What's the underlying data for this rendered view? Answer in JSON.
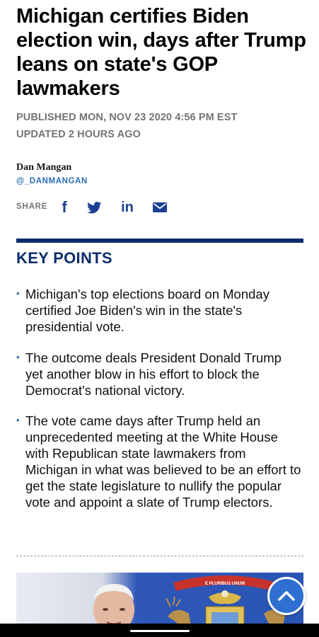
{
  "article": {
    "headline": "Michigan certifies Biden election win, days after Trump leans on state's GOP lawmakers",
    "published": "PUBLISHED MON, NOV 23 2020 4:56 PM EST",
    "updated": "UPDATED 2 HOURS AGO"
  },
  "author": {
    "name": "Dan Mangan",
    "handle": "@_DANMANGAN"
  },
  "share": {
    "label": "SHARE",
    "icons": [
      "facebook-icon",
      "twitter-icon",
      "linkedin-icon",
      "email-icon"
    ],
    "facebook_glyph": "f",
    "linkedin_glyph": "in"
  },
  "key_points": {
    "title": "KEY POINTS",
    "items": [
      "Michigan's top elections board on Monday certified Joe Biden's win in the state's presidential vote.",
      "The outcome deals President Donald Trump yet another blow in his effort to block the Democrat's national victory.",
      "The vote came days after Trump held an unprecedented meeting at the White House with Republican state lawmakers from Michigan in what was believed to be an effort to get the state legislature to nullify the popular vote and appoint a slate of Trump electors."
    ]
  },
  "hero_image": {
    "banner_text": "E PLURIBUS UNUM"
  },
  "colors": {
    "headline": "#000000",
    "meta_gray": "#747474",
    "handle_blue": "#2a6db5",
    "key_points_navy": "#0c2d6b",
    "share_icon_navy": "#1c3f94",
    "scroll_button_blue": "#2e6fd1",
    "flag_blue": "#1f4aa8"
  }
}
